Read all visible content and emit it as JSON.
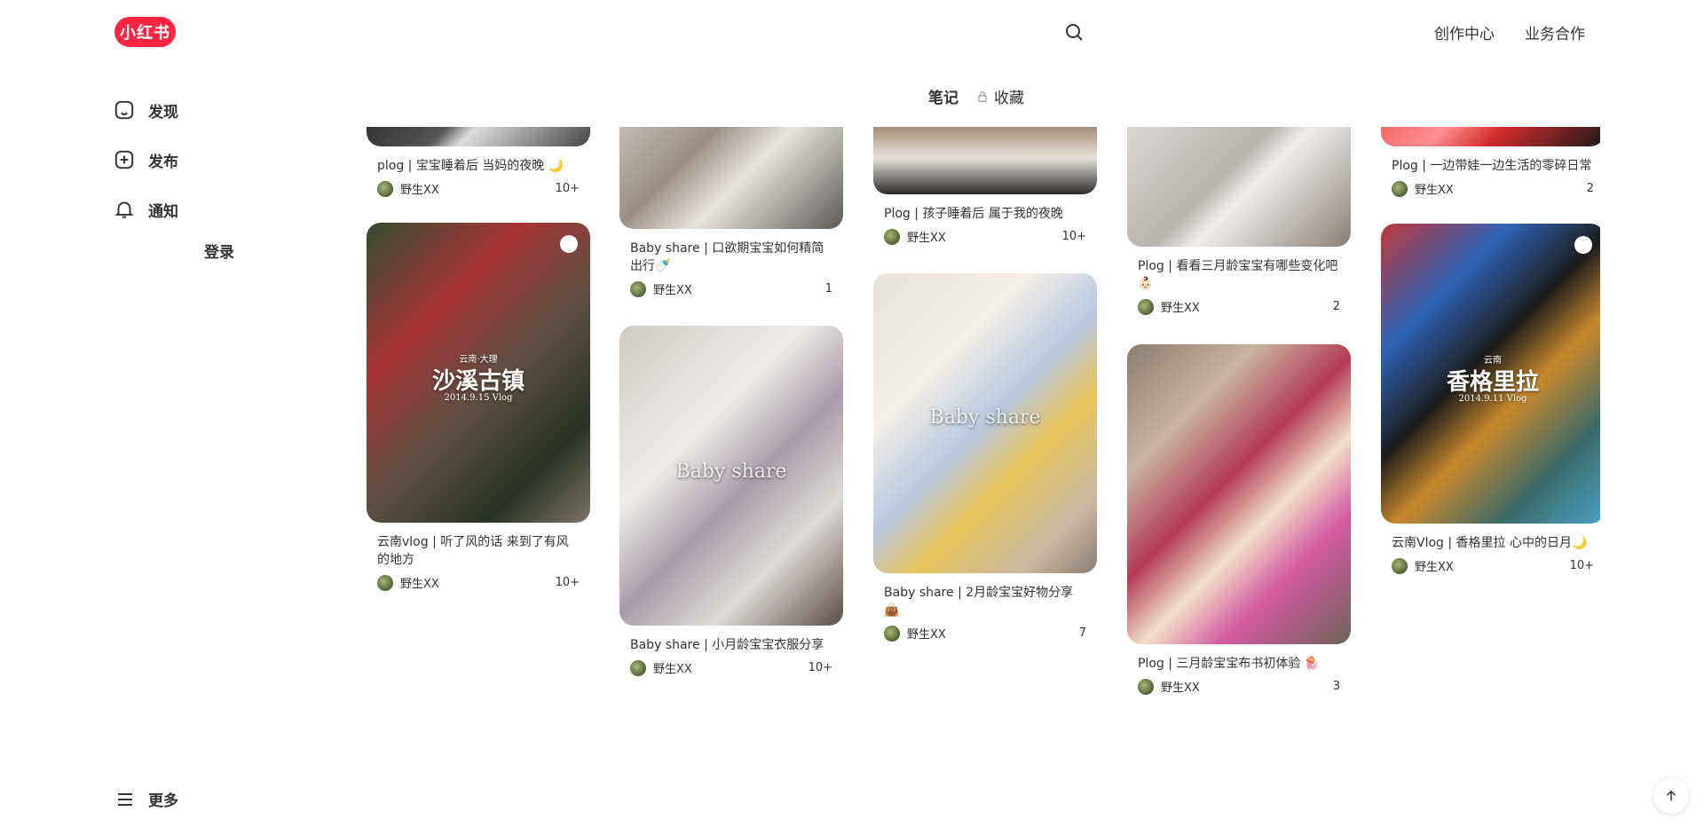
{
  "header": {
    "logo_text": "小红书",
    "top_links": [
      "创作中心",
      "业务合作"
    ]
  },
  "sidebar": {
    "items": [
      {
        "label": "发现",
        "icon": "home-icon"
      },
      {
        "label": "发布",
        "icon": "plus-square-icon"
      },
      {
        "label": "通知",
        "icon": "bell-icon"
      }
    ],
    "login_label": "登录",
    "more_label": "更多"
  },
  "tabs": {
    "notes": "笔记",
    "favorites": "收藏"
  },
  "feed": {
    "columns": [
      [
        {
          "title": "plog | 宝宝睡着后 当妈的夜晚 🌙",
          "author": "野生XX",
          "likes": "10+"
        },
        {
          "title": "云南vlog | 听了风的话 来到了有风的地方",
          "author": "野生XX",
          "likes": "10+",
          "overlay_main": "沙溪古镇",
          "overlay_top": "云南·大理",
          "overlay_sub": "2014.9.15 Vlog"
        }
      ],
      [
        {
          "title": "Baby share | 口欲期宝宝如何精简出行🍼",
          "author": "野生XX",
          "likes": "1"
        },
        {
          "title": "Baby share | 小月龄宝宝衣服分享",
          "author": "野生XX",
          "likes": "10+",
          "overlay_baby": "Baby share"
        }
      ],
      [
        {
          "title": "Plog | 孩子睡着后 属于我的夜晚",
          "author": "野生XX",
          "likes": "10+"
        },
        {
          "title": "Baby share | 2月龄宝宝好物分享👜",
          "author": "野生XX",
          "likes": "7",
          "overlay_baby": "Baby share"
        }
      ],
      [
        {
          "title": "Plog | 看看三月龄宝宝有哪些变化吧👶🏻",
          "author": "野生XX",
          "likes": "2"
        },
        {
          "title": "Plog | 三月龄宝宝布书初体验 🪼",
          "author": "野生XX",
          "likes": "3"
        }
      ],
      [
        {
          "title": "Plog | 一边带娃一边生活的零碎日常",
          "author": "野生XX",
          "likes": "2"
        },
        {
          "title": "云南Vlog | 香格里拉 心中的日月🌙",
          "author": "野生XX",
          "likes": "10+",
          "overlay_main": "香格里拉",
          "overlay_top": "云南",
          "overlay_sub": "2014.9.11 Vlog"
        }
      ]
    ]
  }
}
